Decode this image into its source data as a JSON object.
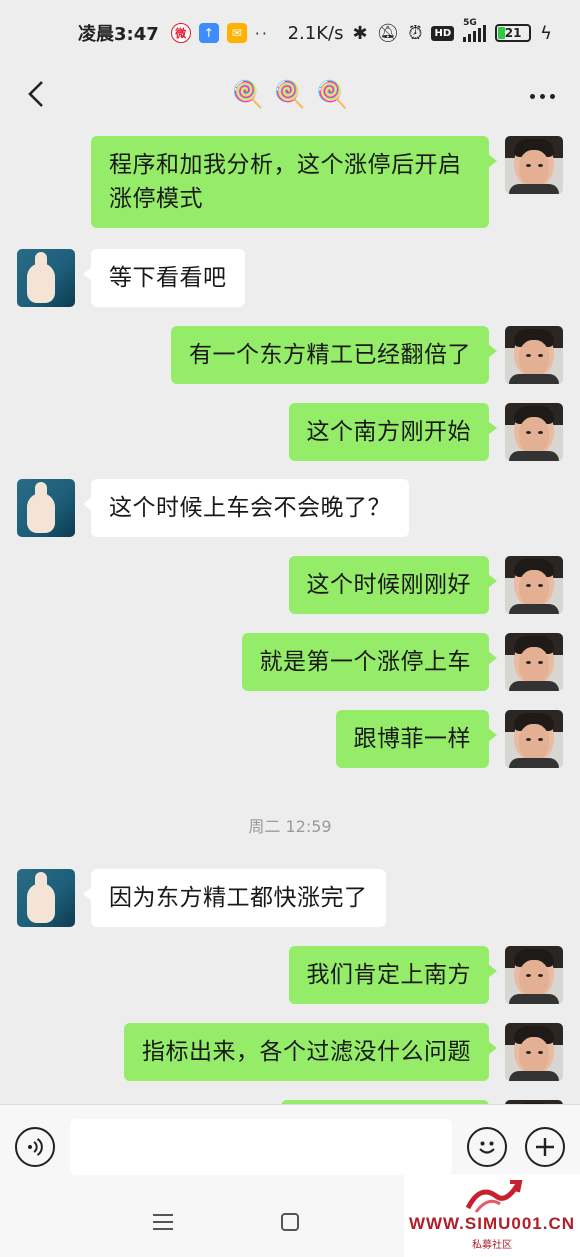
{
  "status_bar": {
    "time": "凌晨3:47",
    "weibo_icon": "weibo-icon",
    "speed": "2.1K/s",
    "hd": "HD",
    "network": "5G",
    "battery": "21"
  },
  "nav": {
    "title_icons": [
      "🍭",
      "🍭",
      "🍭"
    ]
  },
  "messages": [
    {
      "side": "out",
      "lines": [
        "程序和加我分析，这个涨停后开启",
        "涨停模式"
      ]
    },
    {
      "side": "in",
      "lines": [
        "等下看看吧"
      ]
    },
    {
      "side": "out",
      "lines": [
        "有一个东方精工已经翻倍了"
      ]
    },
    {
      "side": "out",
      "lines": [
        "这个南方刚开始"
      ]
    },
    {
      "side": "in",
      "lines": [
        "这个时候上车会不会晚了？"
      ]
    },
    {
      "side": "out",
      "lines": [
        "这个时候刚刚好"
      ]
    },
    {
      "side": "out",
      "lines": [
        "就是第一个涨停上车"
      ]
    },
    {
      "side": "out",
      "lines": [
        "跟博菲一样"
      ]
    },
    {
      "side": "in",
      "lines": [
        "因为东方精工都快涨完了"
      ]
    },
    {
      "side": "out",
      "lines": [
        "我们肯定上南方"
      ]
    },
    {
      "side": "out",
      "lines": [
        "指标出来，各个过滤没什么问题"
      ]
    }
  ],
  "time_divider": "周二 12:59",
  "input": {
    "placeholder": ""
  },
  "watermark": {
    "text": "WWW.SIMU001.CN",
    "sub": "私募社区"
  },
  "colors": {
    "outgoing_bubble": "#95ec69",
    "incoming_bubble": "#ffffff",
    "background": "#ededed"
  }
}
